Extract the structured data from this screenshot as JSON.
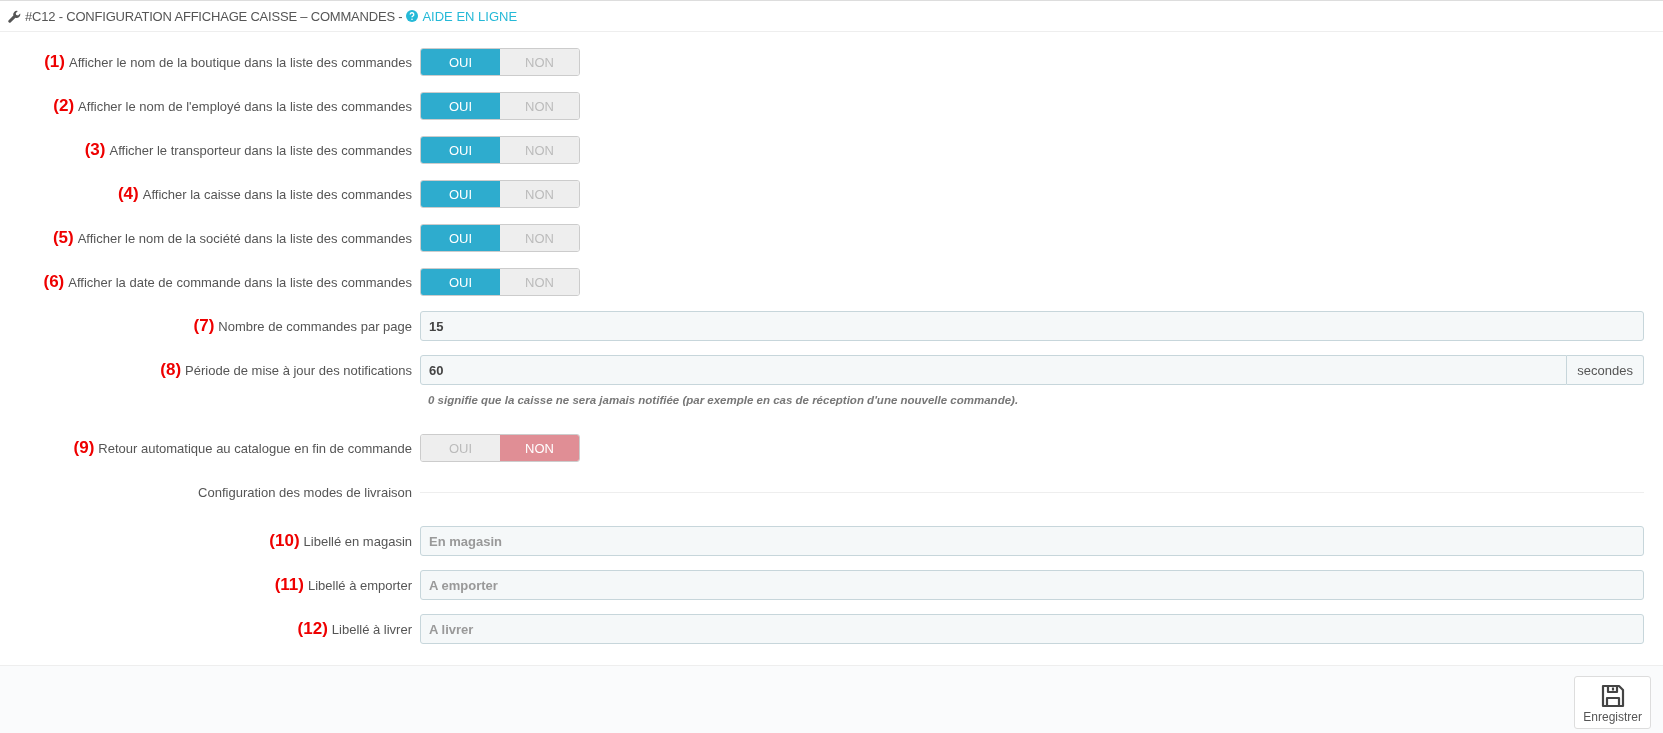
{
  "header": {
    "title": "#C12 - CONFIGURATION AFFICHAGE CAISSE – COMMANDES -",
    "help_link": "AIDE EN LIGNE"
  },
  "rows": [
    {
      "kind": "toggle",
      "marker": "(1)",
      "label": "Afficher le nom de la boutique dans la liste des commandes",
      "options": [
        {
          "label": "OUI",
          "selected": true
        },
        {
          "label": "NON",
          "selected": false
        }
      ]
    },
    {
      "kind": "toggle",
      "marker": "(2)",
      "label": "Afficher le nom de l'employé dans la liste des commandes",
      "options": [
        {
          "label": "OUI",
          "selected": true
        },
        {
          "label": "NON",
          "selected": false
        }
      ]
    },
    {
      "kind": "toggle",
      "marker": "(3)",
      "label": "Afficher le transporteur dans la liste des commandes",
      "options": [
        {
          "label": "OUI",
          "selected": true
        },
        {
          "label": "NON",
          "selected": false
        }
      ]
    },
    {
      "kind": "toggle",
      "marker": "(4)",
      "label": "Afficher la caisse dans la liste des commandes",
      "options": [
        {
          "label": "OUI",
          "selected": true
        },
        {
          "label": "NON",
          "selected": false
        }
      ]
    },
    {
      "kind": "toggle",
      "marker": "(5)",
      "label": "Afficher le nom de la société dans la liste des commandes",
      "options": [
        {
          "label": "OUI",
          "selected": true
        },
        {
          "label": "NON",
          "selected": false
        }
      ]
    },
    {
      "kind": "toggle",
      "marker": "(6)",
      "label": "Afficher la date de commande dans la liste des commandes",
      "options": [
        {
          "label": "OUI",
          "selected": true
        },
        {
          "label": "NON",
          "selected": false
        }
      ]
    },
    {
      "kind": "input",
      "marker": "(7)",
      "label": "Nombre de commandes par page",
      "value": "15"
    },
    {
      "kind": "input",
      "marker": "(8)",
      "label": "Période de mise à jour des notifications",
      "value": "60",
      "suffix": "secondes",
      "help": "0 signifie que la caisse ne sera jamais notifiée (par exemple en cas de réception d'une nouvelle commande)."
    },
    {
      "kind": "toggle",
      "marker": "(9)",
      "label": "Retour automatique au catalogue en fin de commande",
      "options": [
        {
          "label": "OUI",
          "selected": false
        },
        {
          "label": "NON",
          "selected": true
        }
      ]
    },
    {
      "kind": "section",
      "label": "Configuration des modes de livraison"
    },
    {
      "kind": "input",
      "marker": "(10)",
      "label": "Libellé en magasin",
      "placeholder": "En magasin"
    },
    {
      "kind": "input",
      "marker": "(11)",
      "label": "Libellé à emporter",
      "placeholder": "A emporter"
    },
    {
      "kind": "input",
      "marker": "(12)",
      "label": "Libellé à livrer",
      "placeholder": "A livrer"
    }
  ],
  "save_button": {
    "label": "Enregistrer"
  }
}
